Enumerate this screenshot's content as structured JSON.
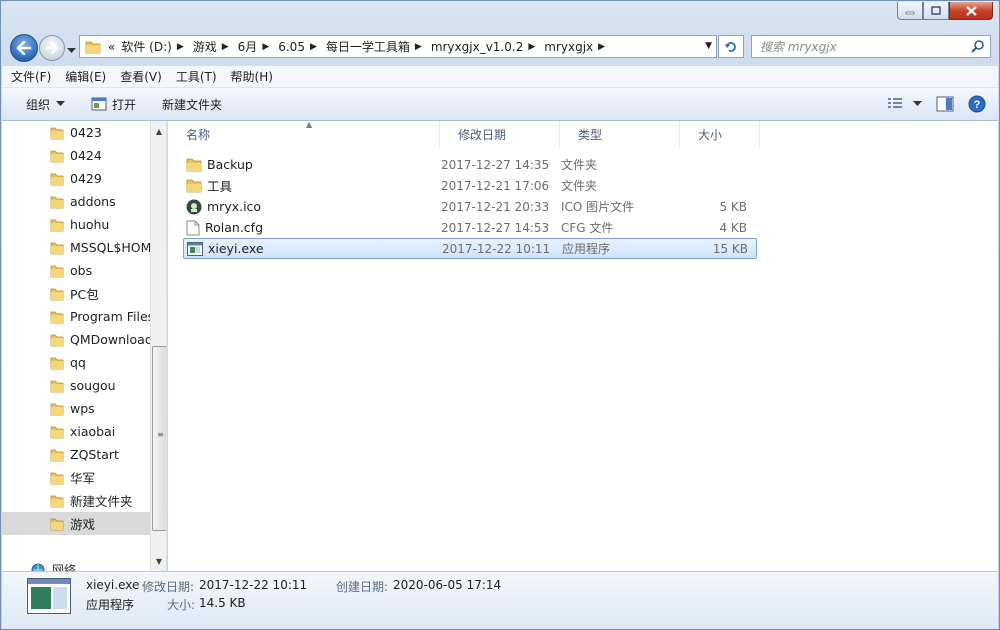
{
  "address": {
    "overflow": "«",
    "segments": [
      "软件 (D:)",
      "游戏",
      "6月",
      "6.05",
      "每日一学工具箱",
      "mryxgjx_v1.0.2",
      "mryxgjx"
    ]
  },
  "search": {
    "placeholder": "搜索 mryxgjx"
  },
  "menu": [
    "文件(F)",
    "编辑(E)",
    "查看(V)",
    "工具(T)",
    "帮助(H)"
  ],
  "commands": {
    "organize": "组织",
    "open": "打开",
    "new_folder": "新建文件夹"
  },
  "tree": {
    "items": [
      "0423",
      "0424",
      "0429",
      "addons",
      "huohu",
      "MSSQL$HOM",
      "obs",
      "PC包",
      "Program Files",
      "QMDownload",
      "qq",
      "sougou",
      "wps",
      "xiaobai",
      "ZQStart",
      "华军",
      "新建文件夹",
      "游戏"
    ],
    "selected": "游戏",
    "network": "网络"
  },
  "columns": {
    "name": "名称",
    "date": "修改日期",
    "type": "类型",
    "size": "大小"
  },
  "files": [
    {
      "name": "Backup",
      "date": "2017-12-27 14:35",
      "type": "文件夹",
      "size": "",
      "icon": "folder-icon"
    },
    {
      "name": "工具",
      "date": "2017-12-21 17:06",
      "type": "文件夹",
      "size": "",
      "icon": "folder-icon"
    },
    {
      "name": "mryx.ico",
      "date": "2017-12-21 20:33",
      "type": "ICO 图片文件",
      "size": "5 KB",
      "icon": "ico-file-icon"
    },
    {
      "name": "Rolan.cfg",
      "date": "2017-12-27 14:53",
      "type": "CFG 文件",
      "size": "4 KB",
      "icon": "document-icon"
    },
    {
      "name": "xieyi.exe",
      "date": "2017-12-22 10:11",
      "type": "应用程序",
      "size": "15 KB",
      "icon": "exe-icon"
    }
  ],
  "selected_file": "xieyi.exe",
  "details": {
    "name": "xieyi.exe",
    "type": "应用程序",
    "modified_label": "修改日期:",
    "modified": "2017-12-22 10:11",
    "created_label": "创建日期:",
    "created": "2020-06-05 17:14",
    "size_label": "大小:",
    "size": "14.5 KB"
  }
}
